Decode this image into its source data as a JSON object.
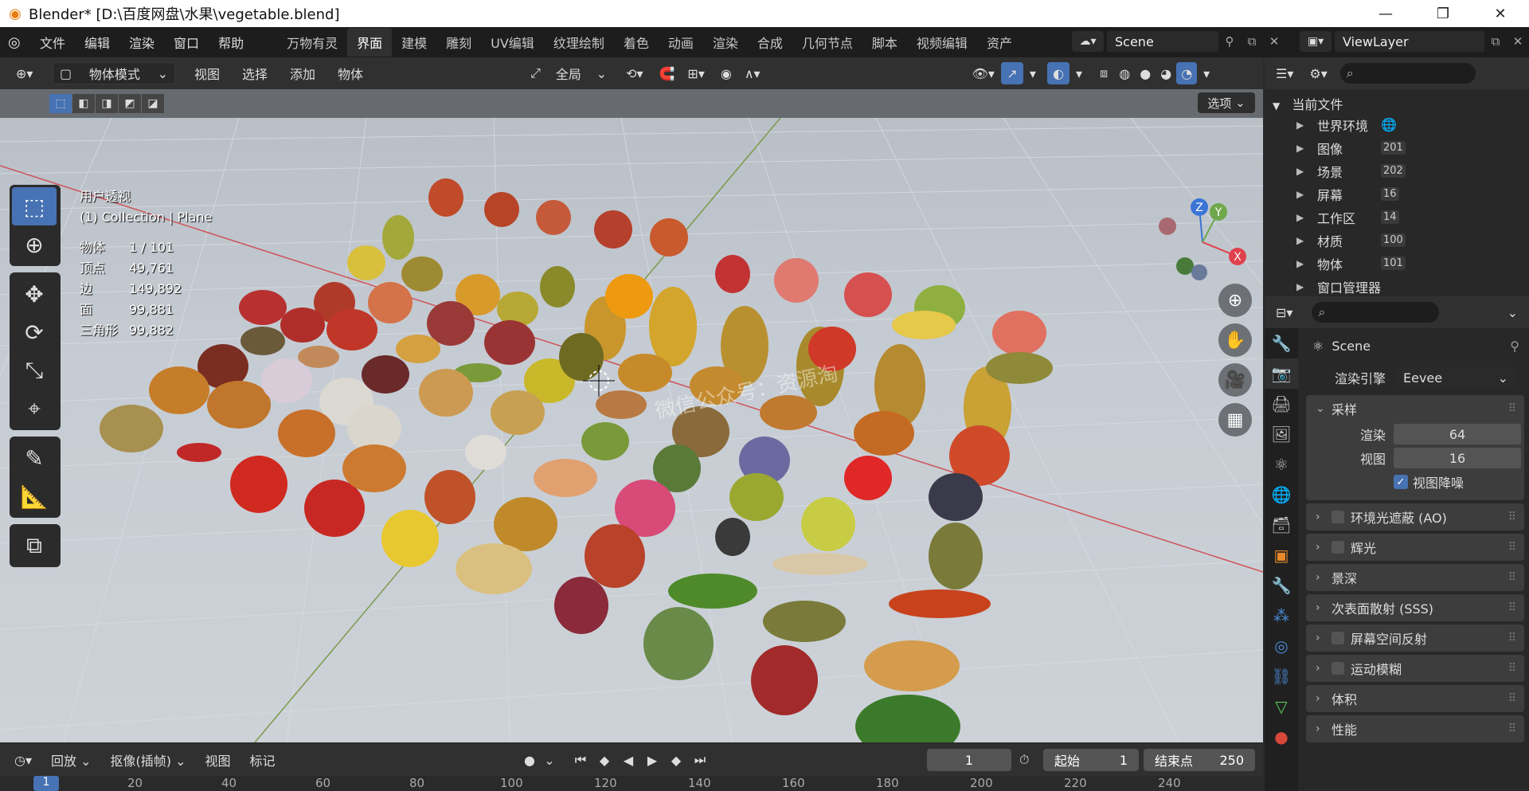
{
  "window": {
    "title": "Blender* [D:\\百度网盘\\水果\\vegetable.blend]",
    "minimize": "—",
    "restore": "❐",
    "close": "✕"
  },
  "menu": [
    "文件",
    "编辑",
    "渲染",
    "窗口",
    "帮助"
  ],
  "workspaces": [
    "万物有灵",
    "界面",
    "建模",
    "雕刻",
    "UV编辑",
    "纹理绘制",
    "着色",
    "动画",
    "渲染",
    "合成",
    "几何节点",
    "脚本",
    "视频编辑",
    "资产"
  ],
  "active_workspace": "界面",
  "scene": {
    "name": "Scene"
  },
  "viewlayer": {
    "name": "ViewLayer"
  },
  "viewport": {
    "mode": "物体模式",
    "menus": [
      "视图",
      "选择",
      "添加",
      "物体"
    ],
    "transform_orientation": "全局",
    "options_label": "选项",
    "view_name": "用户透视",
    "collection": "(1) Collection | Plane",
    "stats": [
      {
        "k": "物体",
        "v": "1 / 101"
      },
      {
        "k": "顶点",
        "v": "49,761"
      },
      {
        "k": "边",
        "v": "149,892"
      },
      {
        "k": "面",
        "v": "99,881"
      },
      {
        "k": "三角形",
        "v": "99,882"
      }
    ],
    "gizmo": {
      "x": "X",
      "y": "Y",
      "z": "Z"
    },
    "last_operator": "移动",
    "watermark": "微信公众号：资源淘"
  },
  "timeline": {
    "playback": "回放",
    "keying": "抠像(插帧)",
    "menus": [
      "视图",
      "标记"
    ],
    "current_frame": "1",
    "start_label": "起始",
    "start": "1",
    "end_label": "结束点",
    "end": "250",
    "ruler": [
      "20",
      "40",
      "60",
      "80",
      "100",
      "120",
      "140",
      "160",
      "180",
      "200",
      "220",
      "240"
    ],
    "cursor": "1"
  },
  "outliner": {
    "root": "当前文件",
    "items": [
      {
        "label": "世界环境",
        "badge": ""
      },
      {
        "label": "图像",
        "badge": "201"
      },
      {
        "label": "场景",
        "badge": "202"
      },
      {
        "label": "屏幕",
        "badge": "16"
      },
      {
        "label": "工作区",
        "badge": "14"
      },
      {
        "label": "材质",
        "badge": "100"
      },
      {
        "label": "物体",
        "badge": "101"
      },
      {
        "label": "窗口管理器",
        "badge": ""
      }
    ]
  },
  "properties": {
    "title": "Scene",
    "render_engine_label": "渲染引擎",
    "render_engine": "Eevee",
    "sampling": {
      "label": "采样",
      "render_label": "渲染",
      "render": "64",
      "viewport_label": "视图",
      "viewport": "16",
      "denoise_label": "视图降噪"
    },
    "panels": [
      {
        "label": "环境光遮蔽 (AO)",
        "checkbox": true
      },
      {
        "label": "辉光",
        "checkbox": true
      },
      {
        "label": "景深",
        "checkbox": false
      },
      {
        "label": "次表面散射 (SSS)",
        "checkbox": false
      },
      {
        "label": "屏幕空间反射",
        "checkbox": true
      },
      {
        "label": "运动模糊",
        "checkbox": true
      },
      {
        "label": "体积",
        "checkbox": false
      },
      {
        "label": "性能",
        "checkbox": false
      }
    ]
  },
  "colors": {
    "accent": "#4772b3",
    "x_axis": "#e0404d",
    "y_axis": "#6fa84b",
    "z_axis": "#3a74d6"
  }
}
